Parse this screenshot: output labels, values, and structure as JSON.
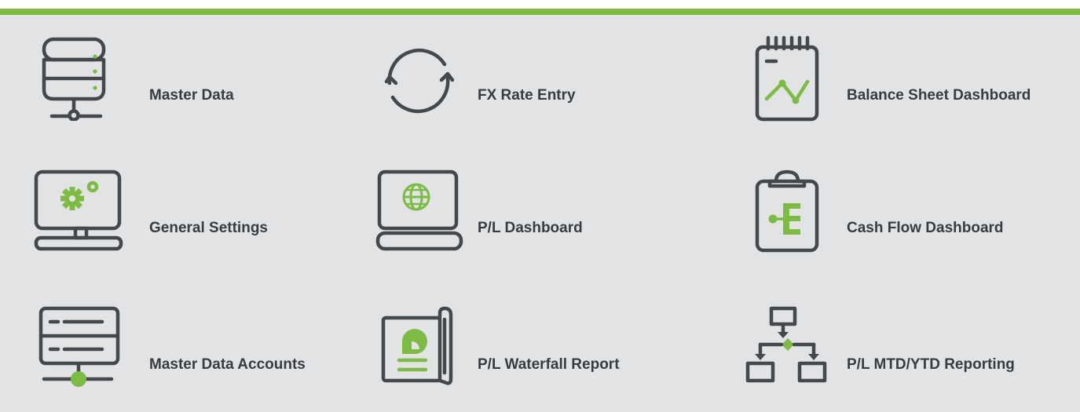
{
  "colors": {
    "accent": "#7dbc42",
    "icon": "#44484d",
    "text": "#383c40",
    "panel": "#e2e3e5"
  },
  "tiles": [
    {
      "label": "Master Data",
      "icon": "database-server-icon"
    },
    {
      "label": "FX Rate Entry",
      "icon": "refresh-arrows-icon"
    },
    {
      "label": "Balance Sheet Dashboard",
      "icon": "notepad-chart-icon"
    },
    {
      "label": "General Settings",
      "icon": "monitor-gear-icon"
    },
    {
      "label": "P/L Dashboard",
      "icon": "laptop-globe-icon"
    },
    {
      "label": "Cash Flow Dashboard",
      "icon": "clipboard-hierarchy-icon"
    },
    {
      "label": "Master Data Accounts",
      "icon": "server-network-icon"
    },
    {
      "label": "P/L Waterfall Report",
      "icon": "report-scroll-icon"
    },
    {
      "label": "P/L MTD/YTD Reporting",
      "icon": "flowchart-icon"
    }
  ]
}
